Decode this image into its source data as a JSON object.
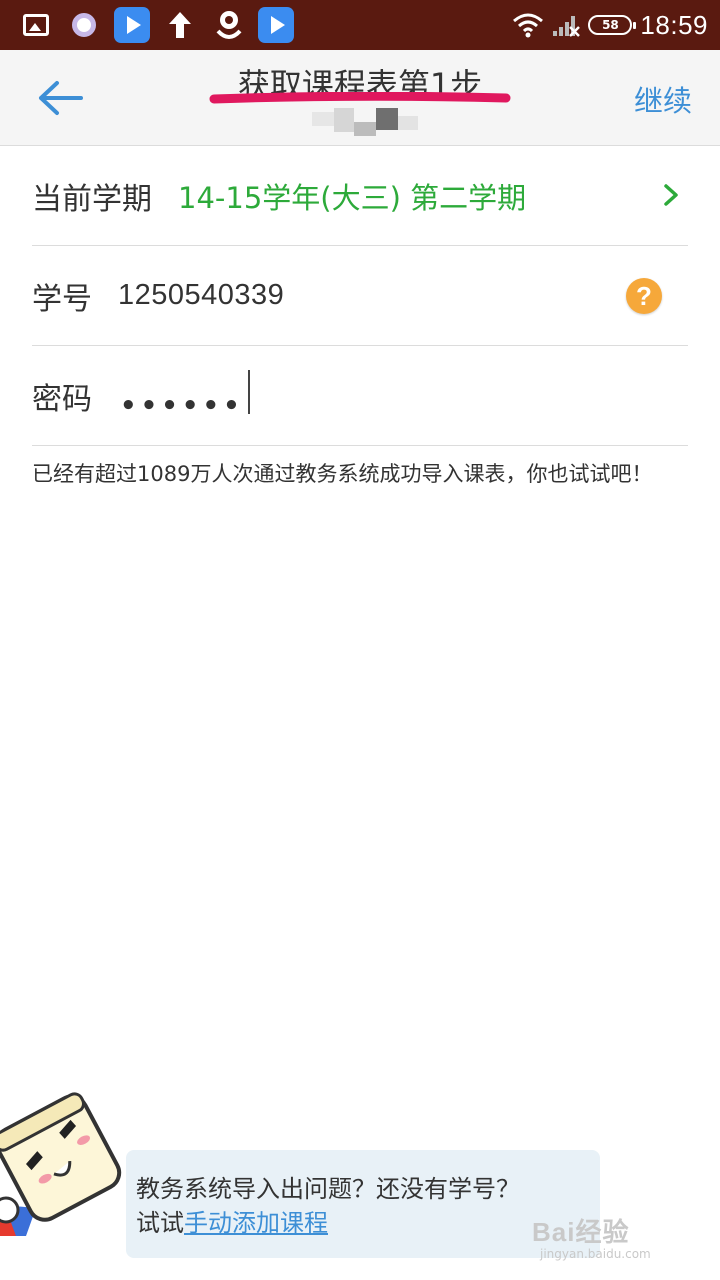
{
  "status_bar": {
    "battery": "58",
    "time": "18:59",
    "icons": [
      "gallery-icon",
      "circle-app-icon",
      "play-app-icon",
      "upload-arrow-icon",
      "pin-icon",
      "play-app-icon",
      "wifi-icon",
      "signal-icon",
      "battery-icon"
    ]
  },
  "header": {
    "title": "获取课程表第1步",
    "continue_label": "继续",
    "back_icon": "arrow-left-icon",
    "underline_color": "#e0185e"
  },
  "form": {
    "term_label": "当前学期",
    "term_value": "14-15学年(大三) 第二学期",
    "student_id_label": "学号",
    "student_id_value": "1250540339",
    "help_symbol": "?",
    "password_label": "密码",
    "password_value": "••••••"
  },
  "info_text": "已经有超过1089万人次通过教务系统成功导入课表，你也试试吧！",
  "bubble": {
    "line1": "教务系统导入出问题？还没有学号？",
    "line2_prefix": "试试",
    "link_label": "手动添加课程"
  },
  "watermark": {
    "main": "Bai经验",
    "sub": "jingyan.baidu.com"
  },
  "colors": {
    "accent_blue": "#3d8fd6",
    "term_green": "#2daa3a",
    "help_orange": "#f6a83a",
    "status_bar_bg": "#5a1a10"
  }
}
